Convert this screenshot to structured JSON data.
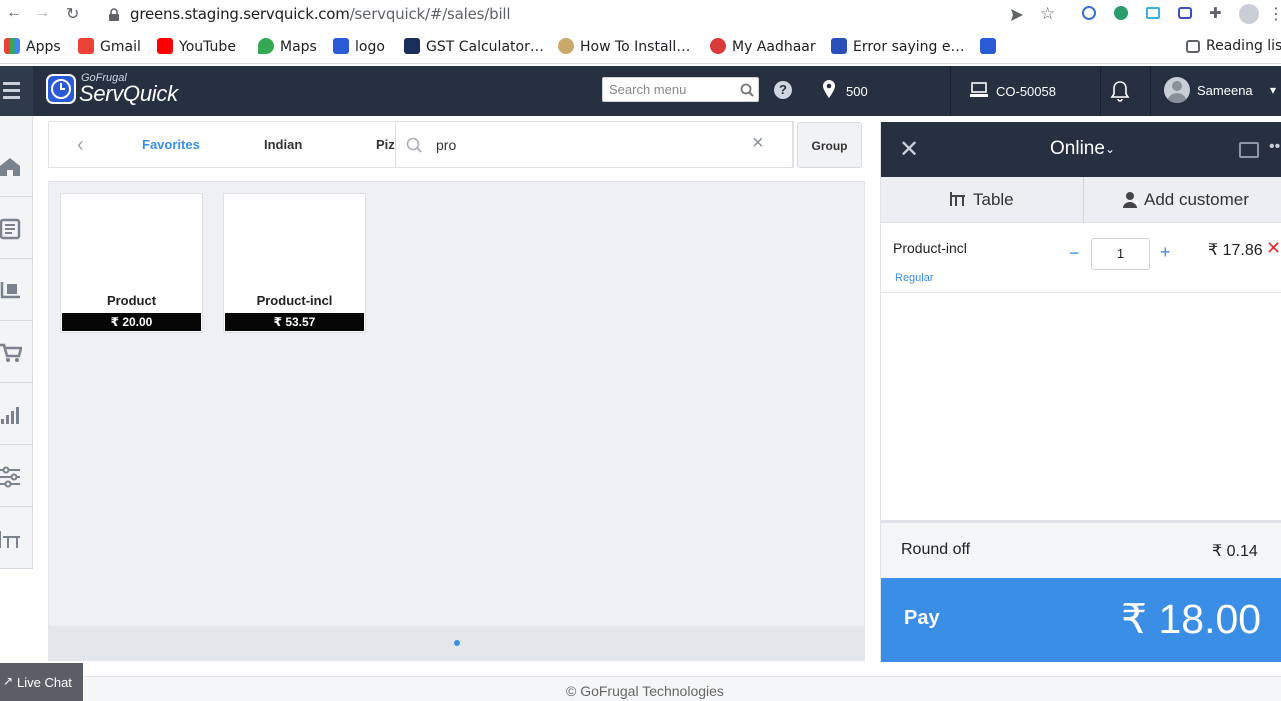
{
  "browser": {
    "url_host": "greens.staging.servquick.com",
    "url_path": "/servquick/#/sales/bill",
    "bookmarks": [
      "Apps",
      "Gmail",
      "YouTube",
      "Maps",
      "logo",
      "GST Calculator…",
      "How To Install…",
      "My Aadhaar",
      "Error saying e…"
    ],
    "reading_list": "Reading list"
  },
  "header": {
    "brand_small": "GoFrugal",
    "brand_big": "ServQuick",
    "search_placeholder": "Search menu",
    "location": "500",
    "outlet": "CO-50058",
    "user": "Sameena"
  },
  "categories": {
    "items": [
      "Favorites",
      "Indian",
      "Piz"
    ],
    "active": "Favorites",
    "group_button": "Group"
  },
  "product_search": {
    "value": "pro"
  },
  "products": [
    {
      "name": "Product",
      "price": "₹ 20.00"
    },
    {
      "name": "Product-incl",
      "price": "₹ 53.57"
    }
  ],
  "bill": {
    "mode": "Online",
    "tabs": [
      "Table",
      "Add customer"
    ],
    "line_item": {
      "name": "Product-incl",
      "sub": "Regular",
      "qty": "1",
      "amount": "₹ 17.86"
    },
    "roundoff_label": "Round off",
    "roundoff_value": "₹ 0.14",
    "pay_label": "Pay",
    "pay_amount": "₹ 18.00"
  },
  "footer": {
    "copyright": "© GoFrugal Technologies",
    "live_chat": "Live Chat"
  },
  "colors": {
    "header_bg": "#263040",
    "accent": "#3a8ee6",
    "remove": "#e53030"
  }
}
